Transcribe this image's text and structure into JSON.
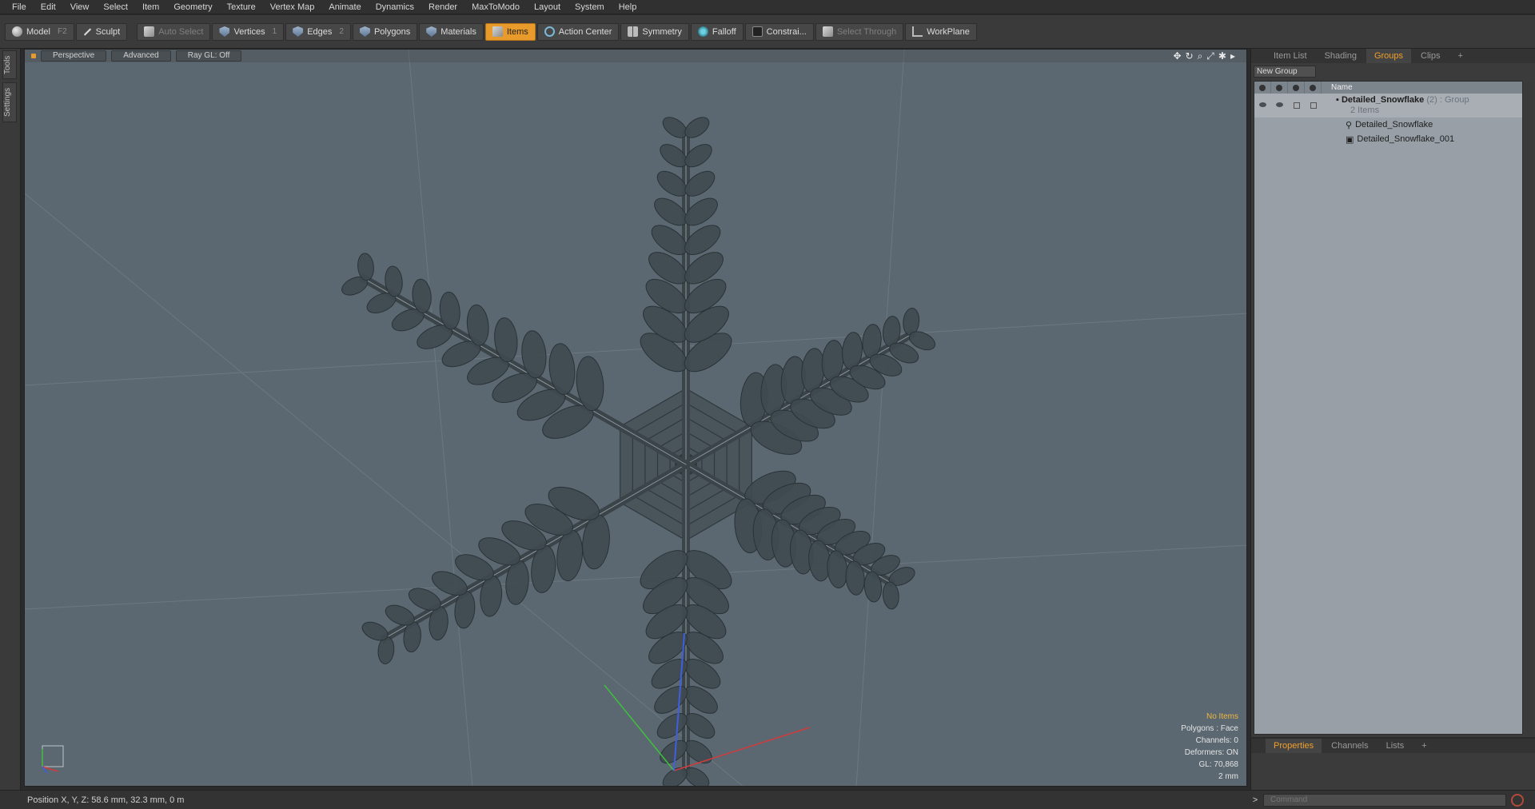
{
  "menu": [
    "File",
    "Edit",
    "View",
    "Select",
    "Item",
    "Geometry",
    "Texture",
    "Vertex Map",
    "Animate",
    "Dynamics",
    "Render",
    "MaxToModo",
    "Layout",
    "System",
    "Help"
  ],
  "toolbar": {
    "model": "Model",
    "model_key": "F2",
    "sculpt": "Sculpt",
    "auto_select": "Auto Select",
    "vertices": "Vertices",
    "vertices_key": "1",
    "edges": "Edges",
    "edges_key": "2",
    "polygons": "Polygons",
    "materials": "Materials",
    "items": "Items",
    "action_center": "Action Center",
    "symmetry": "Symmetry",
    "falloff": "Falloff",
    "constraints": "Constrai...",
    "select_through": "Select Through",
    "workplane": "WorkPlane"
  },
  "left_tabs": [
    "Tools",
    "Settings"
  ],
  "viewport": {
    "view_mode": "Perspective",
    "shading": "Advanced",
    "raygl": "Ray GL: Off",
    "info": {
      "items": "No Items",
      "polygons": "Polygons : Face",
      "channels": "Channels: 0",
      "deformers": "Deformers: ON",
      "gl": "GL: 70,868",
      "scale": "2 mm"
    }
  },
  "right_panel": {
    "tabs": [
      "Item List",
      "Shading",
      "Groups",
      "Clips"
    ],
    "active_tab": "Groups",
    "new_group": "New Group",
    "column_name": "Name",
    "group": {
      "name": "Detailed_Snowflake",
      "count": "(2)",
      "type": ": Group",
      "items_label": "2 Items"
    },
    "children": [
      "Detailed_Snowflake",
      "Detailed_Snowflake_001"
    ]
  },
  "bottom_tabs": [
    "Properties",
    "Channels",
    "Lists"
  ],
  "status": {
    "position": "Position X, Y, Z:   58.6 mm, 32.3 mm, 0 m",
    "command_placeholder": "Command",
    "prompt": ">"
  },
  "colors": {
    "accent": "#e89a2a",
    "viewport_bg": "#5b6871",
    "snowflake": "#3f4a50"
  }
}
